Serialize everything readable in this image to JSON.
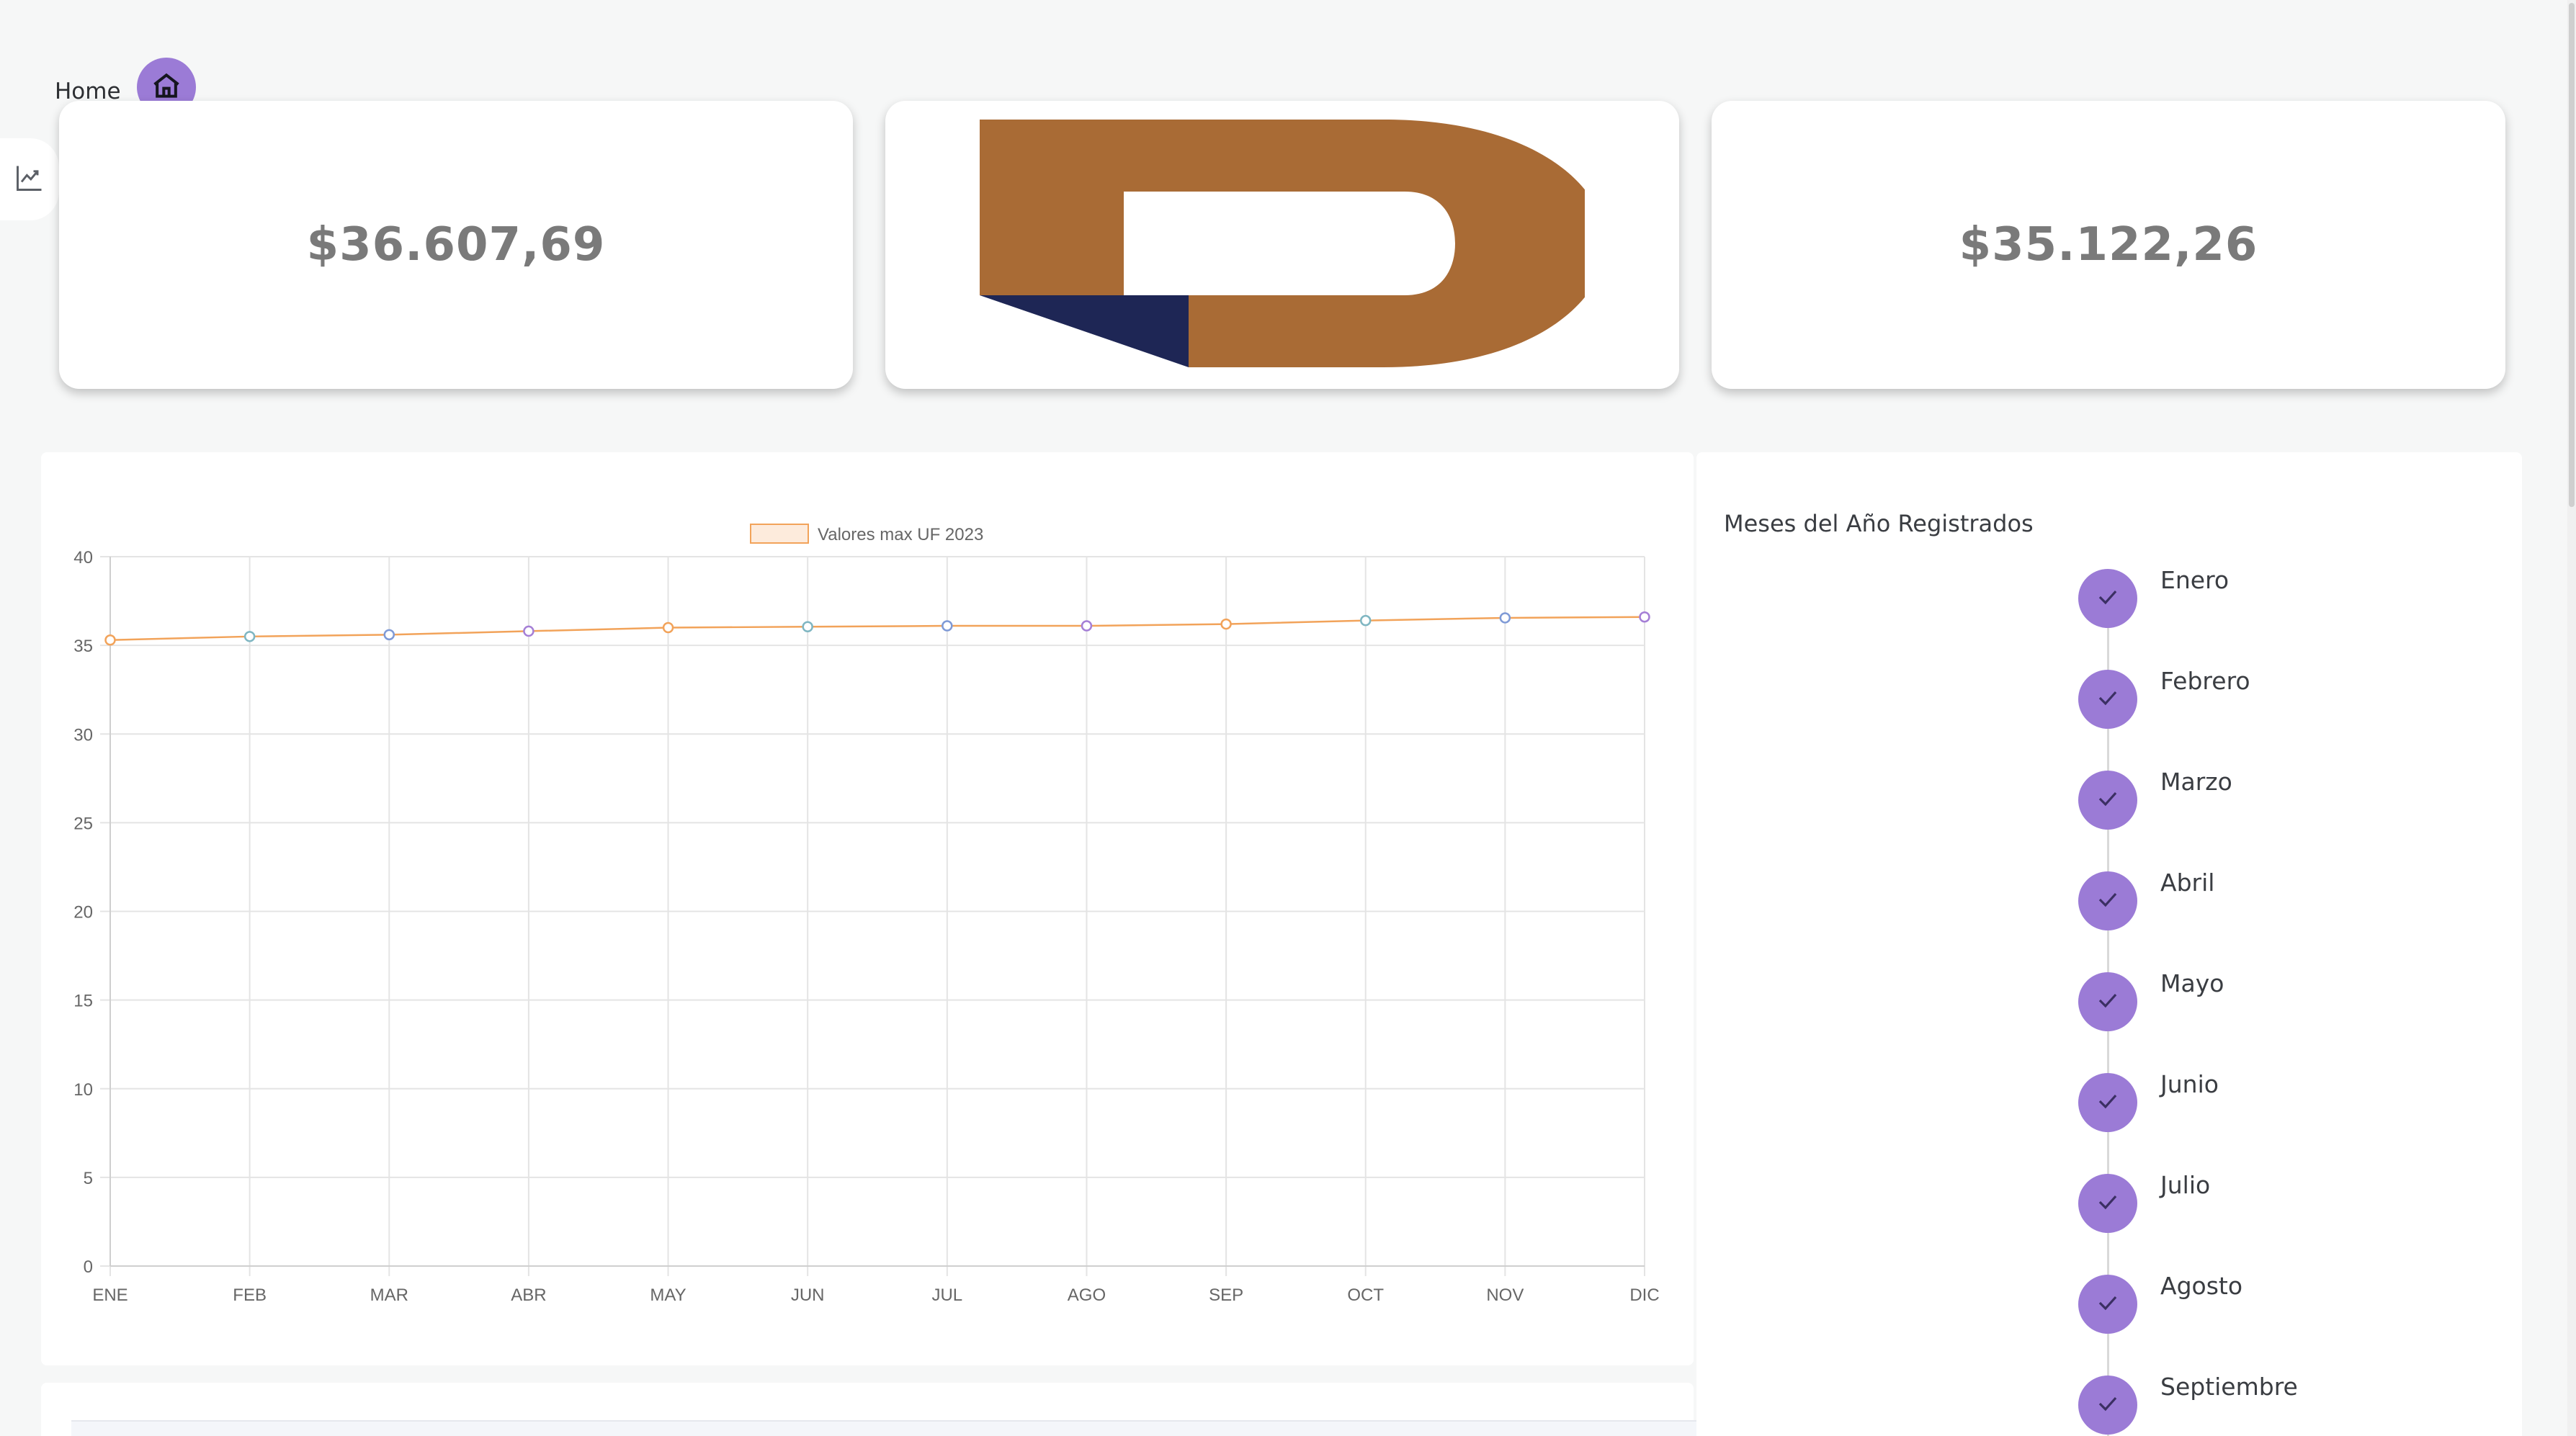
{
  "breadcrumb": {
    "label": "Home"
  },
  "icons": {
    "home": "home-icon",
    "rail": "chart-line-icon",
    "check": "check-icon"
  },
  "colors": {
    "accent": "#9b7bd6",
    "line": "#f2a35a",
    "logo_brown": "#a96b35",
    "logo_navy": "#1e2655"
  },
  "cards": {
    "left_value": "$36.607,69",
    "right_value": "$35.122,26"
  },
  "chart_data": {
    "type": "line",
    "categories": [
      "ENE",
      "FEB",
      "MAR",
      "ABR",
      "MAY",
      "JUN",
      "JUL",
      "AGO",
      "SEP",
      "OCT",
      "NOV",
      "DIC"
    ],
    "series": [
      {
        "name": "Valores max UF 2023",
        "values": [
          35.3,
          35.5,
          35.6,
          35.8,
          36.0,
          36.05,
          36.1,
          36.1,
          36.2,
          36.4,
          36.55,
          36.6
        ]
      }
    ],
    "point_colors": [
      "#f2a35a",
      "#7fb6c2",
      "#7f9ad6",
      "#a57fd6",
      "#f2a35a",
      "#7fb6c2",
      "#7f9ad6",
      "#a57fd6",
      "#f2a35a",
      "#7fb6c2",
      "#7f9ad6",
      "#a57fd6"
    ],
    "ylim": [
      0,
      40
    ],
    "yticks": [
      0,
      5,
      10,
      15,
      20,
      25,
      30,
      35,
      40
    ],
    "grid": true,
    "legend": "top-center"
  },
  "months_panel": {
    "title": "Meses del Año Registrados",
    "items": [
      "Enero",
      "Febrero",
      "Marzo",
      "Abril",
      "Mayo",
      "Junio",
      "Julio",
      "Agosto",
      "Septiembre"
    ]
  }
}
